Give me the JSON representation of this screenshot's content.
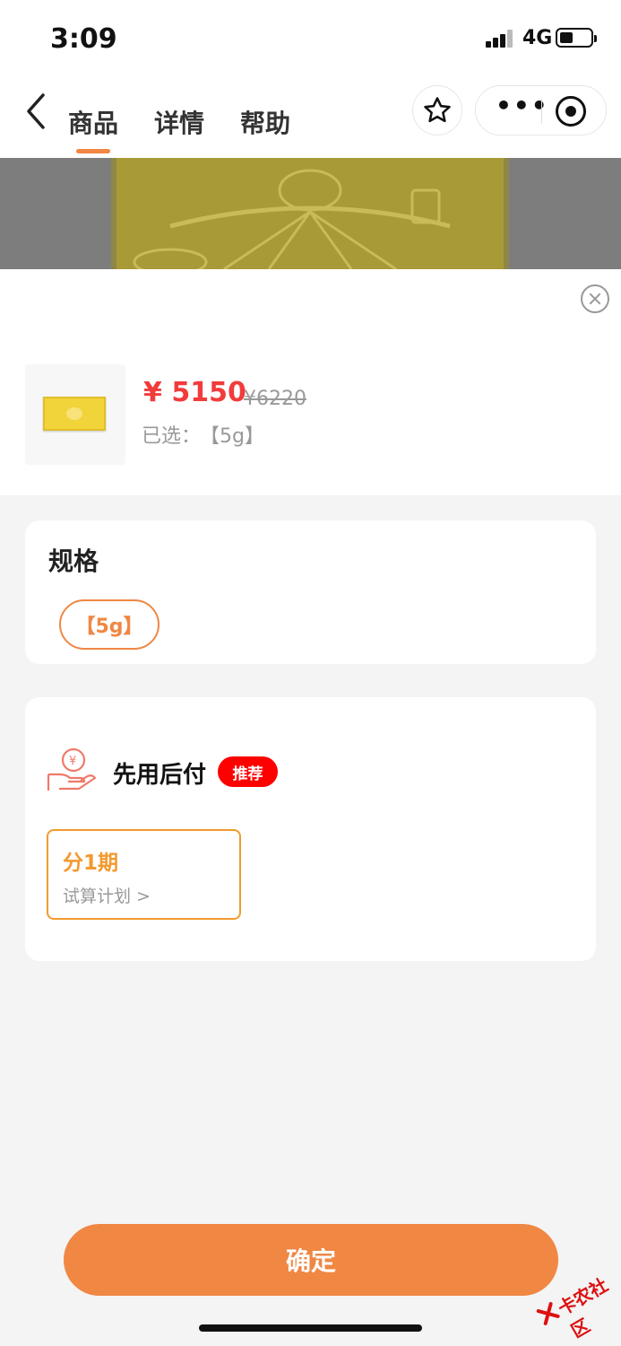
{
  "status_bar": {
    "time": "3:09",
    "network": "4G"
  },
  "nav": {
    "tabs": [
      {
        "label": "商品",
        "active": true
      },
      {
        "label": "详情",
        "active": false
      },
      {
        "label": "帮助",
        "active": false
      }
    ],
    "accent_color": "#f08743"
  },
  "product": {
    "price": "¥ 5150",
    "original_price": "¥6220",
    "selected_label": "已选：",
    "selected_value": "【5g】"
  },
  "spec": {
    "title": "规格",
    "options": [
      "【5g】"
    ]
  },
  "payment": {
    "title": "先用后付",
    "badge": "推荐",
    "plan_title": "分1期",
    "plan_sub": "试算计划 >"
  },
  "confirm_label": "确定",
  "watermark": "卡农社区"
}
